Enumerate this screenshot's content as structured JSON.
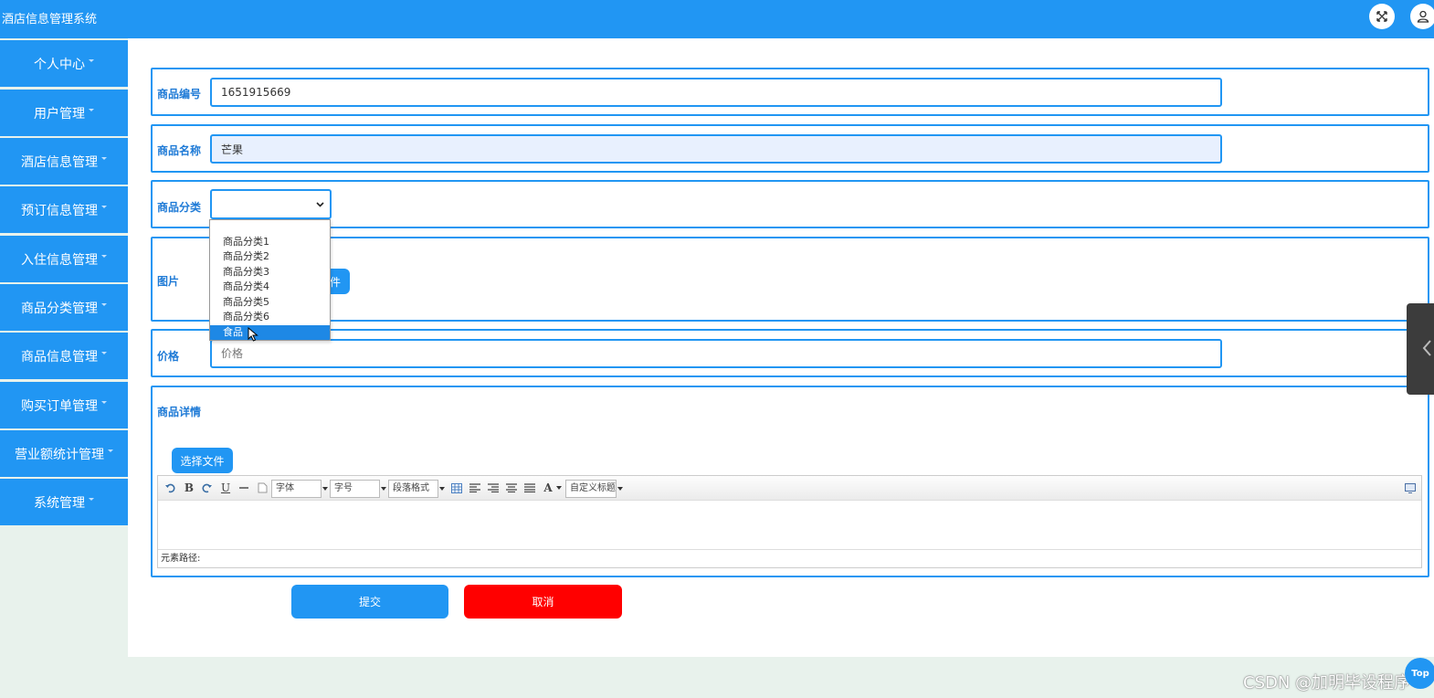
{
  "app": {
    "title": "酒店信息管理系统"
  },
  "header": {
    "icons": [
      "fullscreen-icon",
      "user-icon"
    ]
  },
  "sidebar": {
    "items": [
      {
        "label": "个人中心"
      },
      {
        "label": "用户管理"
      },
      {
        "label": "酒店信息管理"
      },
      {
        "label": "预订信息管理"
      },
      {
        "label": "入住信息管理"
      },
      {
        "label": "商品分类管理"
      },
      {
        "label": "商品信息管理"
      },
      {
        "label": "购买订单管理"
      },
      {
        "label": "营业额统计管理"
      },
      {
        "label": "系统管理"
      }
    ]
  },
  "form": {
    "code": {
      "label": "商品编号",
      "value": "1651915669"
    },
    "name": {
      "label": "商品名称",
      "value": "芒果"
    },
    "category": {
      "label": "商品分类",
      "value": "",
      "options": [
        "商品分类1",
        "商品分类2",
        "商品分类3",
        "商品分类4",
        "商品分类5",
        "商品分类6",
        "食品"
      ],
      "highlighted": "食品"
    },
    "image": {
      "label": "图片",
      "upload_label_partial": "件"
    },
    "price": {
      "label": "价格",
      "placeholder": "价格",
      "value": ""
    },
    "detail": {
      "label": "商品详情",
      "upload_label": "选择文件"
    }
  },
  "editor": {
    "font_family": "字体",
    "font_size": "字号",
    "paragraph": "段落格式",
    "custom_heading": "自定义标题",
    "bold": "B",
    "underline": "U",
    "font_color": "A",
    "status": "元素路径:"
  },
  "actions": {
    "submit": "提交",
    "cancel": "取消"
  },
  "overlay": {
    "watermark": "CSDN @加明毕设程序",
    "top_button": "Top"
  },
  "colors": {
    "primary": "#2196f3",
    "danger": "#ff0000",
    "sidebar_bg": "#e8f2ec"
  }
}
